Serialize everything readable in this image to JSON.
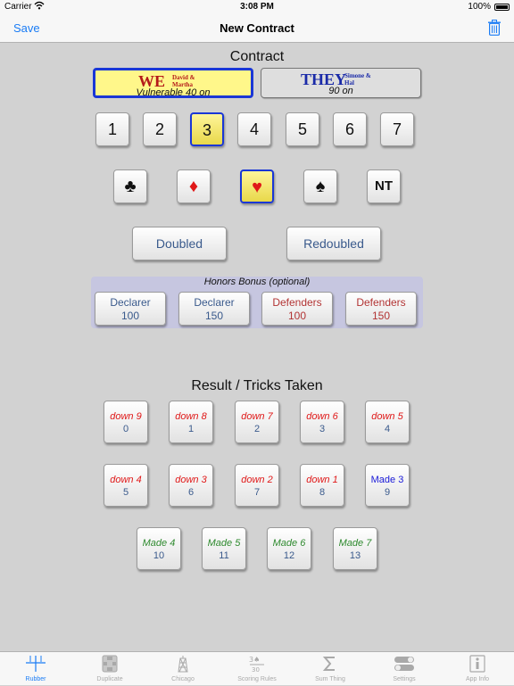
{
  "status_bar": {
    "carrier": "Carrier",
    "time": "3:08 PM",
    "battery": "100%"
  },
  "nav": {
    "save_label": "Save",
    "title": "New Contract",
    "trash_icon": "trash-icon"
  },
  "contract": {
    "heading": "Contract",
    "we": {
      "name": "WE",
      "players": [
        "David &",
        "Martha"
      ],
      "status": "Vulnerable 40 on",
      "selected": true
    },
    "they": {
      "name": "THEY",
      "players": [
        "Simone &",
        "Hal"
      ],
      "status": "90 on",
      "selected": false
    },
    "levels": [
      "1",
      "2",
      "3",
      "4",
      "5",
      "6",
      "7"
    ],
    "selected_level": "3",
    "suits": [
      {
        "symbol": "♣",
        "icon": "club-icon",
        "color": "#111111"
      },
      {
        "symbol": "♦",
        "icon": "diamond-icon",
        "color": "#e01818"
      },
      {
        "symbol": "♥",
        "icon": "heart-icon",
        "color": "#e01818"
      },
      {
        "symbol": "♠",
        "icon": "spade-icon",
        "color": "#111111"
      },
      {
        "symbol": "NT",
        "icon": "no-trump",
        "color": "#111111"
      }
    ],
    "selected_suit": "heart-icon",
    "doubled_label": "Doubled",
    "redoubled_label": "Redoubled"
  },
  "honors": {
    "title": "Honors Bonus (optional)",
    "buttons": [
      {
        "side": "Declarer",
        "points": "100"
      },
      {
        "side": "Declarer",
        "points": "150"
      },
      {
        "side": "Defenders",
        "points": "100"
      },
      {
        "side": "Defenders",
        "points": "150"
      }
    ]
  },
  "result": {
    "heading": "Result / Tricks Taken",
    "rows": [
      [
        {
          "label": "down 9",
          "tricks": "0"
        },
        {
          "label": "down 8",
          "tricks": "1"
        },
        {
          "label": "down 7",
          "tricks": "2"
        },
        {
          "label": "down 6",
          "tricks": "3"
        },
        {
          "label": "down 5",
          "tricks": "4"
        }
      ],
      [
        {
          "label": "down 4",
          "tricks": "5"
        },
        {
          "label": "down 3",
          "tricks": "6"
        },
        {
          "label": "down 2",
          "tricks": "7"
        },
        {
          "label": "down 1",
          "tricks": "8"
        },
        {
          "label": "Made 3",
          "tricks": "9"
        }
      ],
      [
        {
          "label": "Made 4",
          "tricks": "10"
        },
        {
          "label": "Made 5",
          "tricks": "11"
        },
        {
          "label": "Made 6",
          "tricks": "12"
        },
        {
          "label": "Made 7",
          "tricks": "13"
        }
      ]
    ]
  },
  "tabs": [
    {
      "label": "Rubber",
      "icon": "rubber-scoresheet-icon",
      "active": true
    },
    {
      "label": "Duplicate",
      "icon": "duplicate-board-icon",
      "active": false
    },
    {
      "label": "Chicago",
      "icon": "chicago-tower-icon",
      "active": false
    },
    {
      "label": "Scoring Rules",
      "icon": "scoring-rules-icon",
      "active": false
    },
    {
      "label": "Sum Thing",
      "icon": "sigma-icon",
      "active": false
    },
    {
      "label": "Settings",
      "icon": "settings-toggle-icon",
      "active": false
    },
    {
      "label": "App Info",
      "icon": "info-icon",
      "active": false
    }
  ],
  "colors": {
    "accent": "#1a7cf5",
    "selection_border": "#1a37d6",
    "selection_fill": "#fff78a",
    "down_text": "#e01818",
    "made_text": "#2f8a2f"
  }
}
